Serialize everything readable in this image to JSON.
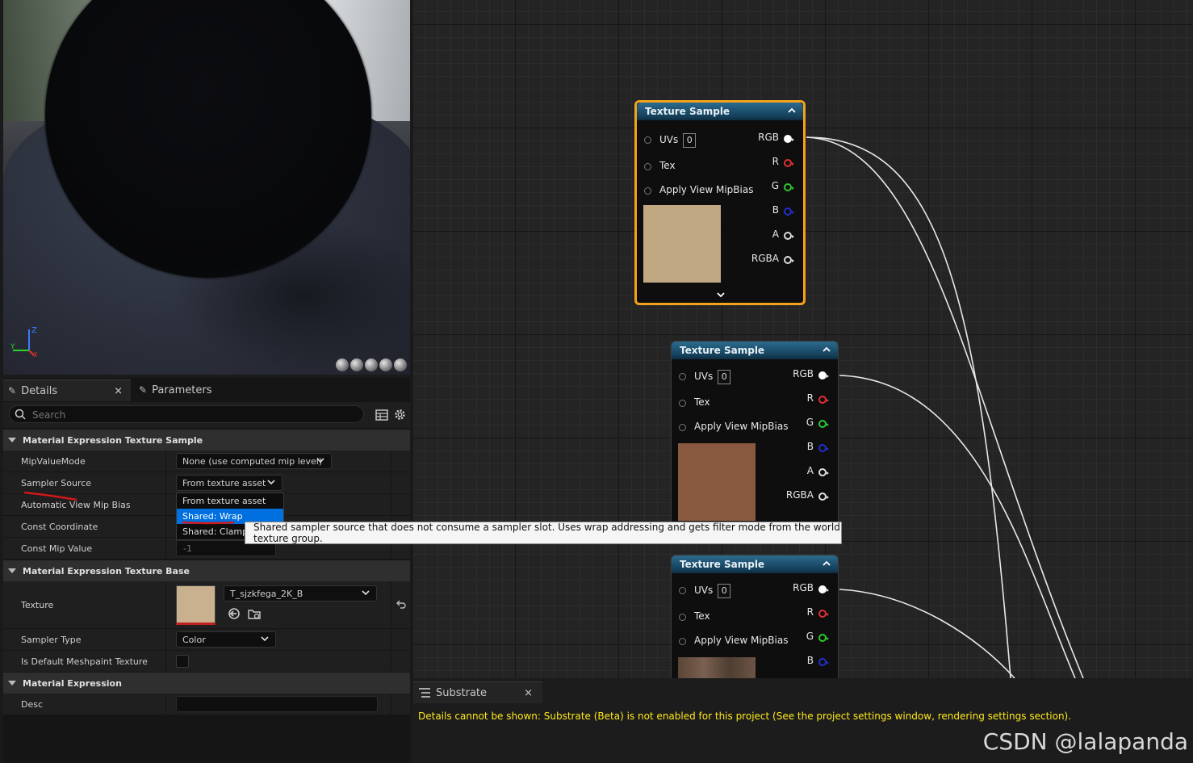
{
  "details": {
    "tabs": [
      {
        "label": "Details",
        "icon": "pencil-icon",
        "active": true
      },
      {
        "label": "Parameters",
        "icon": "pencil-icon",
        "active": false
      }
    ],
    "close_glyph": "×",
    "search": {
      "placeholder": "Search"
    },
    "sections": [
      {
        "title": "Material Expression Texture Sample"
      },
      {
        "title": "Material Expression Texture Base"
      },
      {
        "title": "Material Expression"
      }
    ],
    "props": {
      "mip_value_mode": {
        "label": "MipValueMode",
        "value": "None (use computed mip level)"
      },
      "sampler_source": {
        "label": "Sampler Source",
        "value": "From texture asset"
      },
      "auto_view_mip_bias": {
        "label": "Automatic View Mip Bias"
      },
      "const_coordinate": {
        "label": "Const Coordinate"
      },
      "const_mip_value": {
        "label": "Const Mip Value",
        "value": "-1"
      },
      "texture": {
        "label": "Texture",
        "value": "T_sjzkfega_2K_B"
      },
      "sampler_type": {
        "label": "Sampler Type",
        "value": "Color"
      },
      "default_meshpaint": {
        "label": "Is Default Meshpaint Texture"
      },
      "desc": {
        "label": "Desc",
        "value": ""
      }
    }
  },
  "sampler_dropdown": {
    "options": [
      "From texture asset",
      "Shared: Wrap",
      "Shared: Clamp"
    ],
    "selected": "Shared: Wrap"
  },
  "tooltip": "Shared sampler source that does not consume a sampler slot.  Uses wrap addressing and gets filter mode from the world texture group.",
  "nodes": [
    {
      "title": "Texture Sample",
      "uvs": "0",
      "inputs": [
        "UVs",
        "Tex",
        "Apply View MipBias"
      ],
      "outputs": [
        "RGB",
        "R",
        "G",
        "B",
        "A",
        "RGBA"
      ],
      "thumb_color": "#c0a882",
      "selected": true
    },
    {
      "title": "Texture Sample",
      "uvs": "0",
      "inputs": [
        "UVs",
        "Tex",
        "Apply View MipBias"
      ],
      "outputs": [
        "RGB",
        "R",
        "G",
        "B",
        "A",
        "RGBA"
      ],
      "thumb_color": "#8a5a40",
      "selected": false
    },
    {
      "title": "Texture Sample",
      "uvs": "0",
      "inputs": [
        "UVs",
        "Tex",
        "Apply View MipBias"
      ],
      "outputs": [
        "RGB",
        "R",
        "G",
        "B"
      ],
      "thumb_color": "#6a5040",
      "selected": false
    }
  ],
  "substrate": {
    "tab_label": "Substrate",
    "close_glyph": "×",
    "message": "Details cannot be shown: Substrate (Beta) is not enabled for this project (See the project settings window, rendering settings section)."
  },
  "watermark": "CSDN @lalapanda",
  "axis": {
    "z": "Z",
    "y": "Y",
    "x": "X"
  },
  "colors": {
    "selection": "#0070e0",
    "node_select": "#f4a11b",
    "warning": "#ffe81a"
  }
}
